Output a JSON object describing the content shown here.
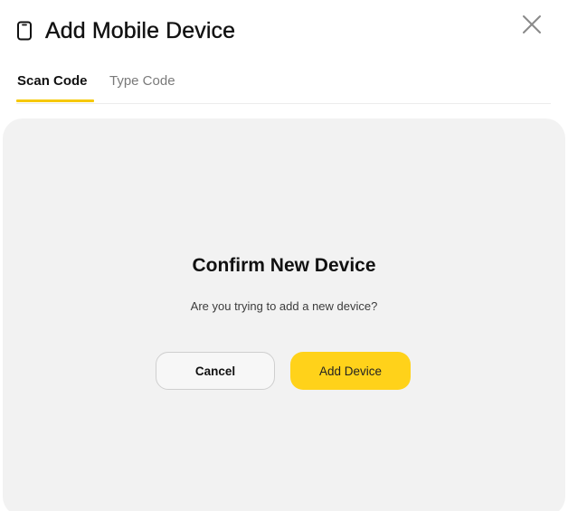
{
  "dialog": {
    "title": "Add Mobile Device",
    "title_icon": "mobile-phone-icon",
    "close_icon": "close-icon"
  },
  "tabs": [
    {
      "label": "Scan Code",
      "active": true
    },
    {
      "label": "Type Code",
      "active": false
    }
  ],
  "confirm": {
    "title": "Confirm New Device",
    "subtitle": "Are you trying to add a new device?",
    "cancel_label": "Cancel",
    "add_label": "Add Device"
  },
  "colors": {
    "accent": "#ffd21a",
    "tab_underline": "#f6c800",
    "panel_bg": "#f2f2f2",
    "text_primary": "#111111",
    "text_muted": "#7a7a7a"
  }
}
